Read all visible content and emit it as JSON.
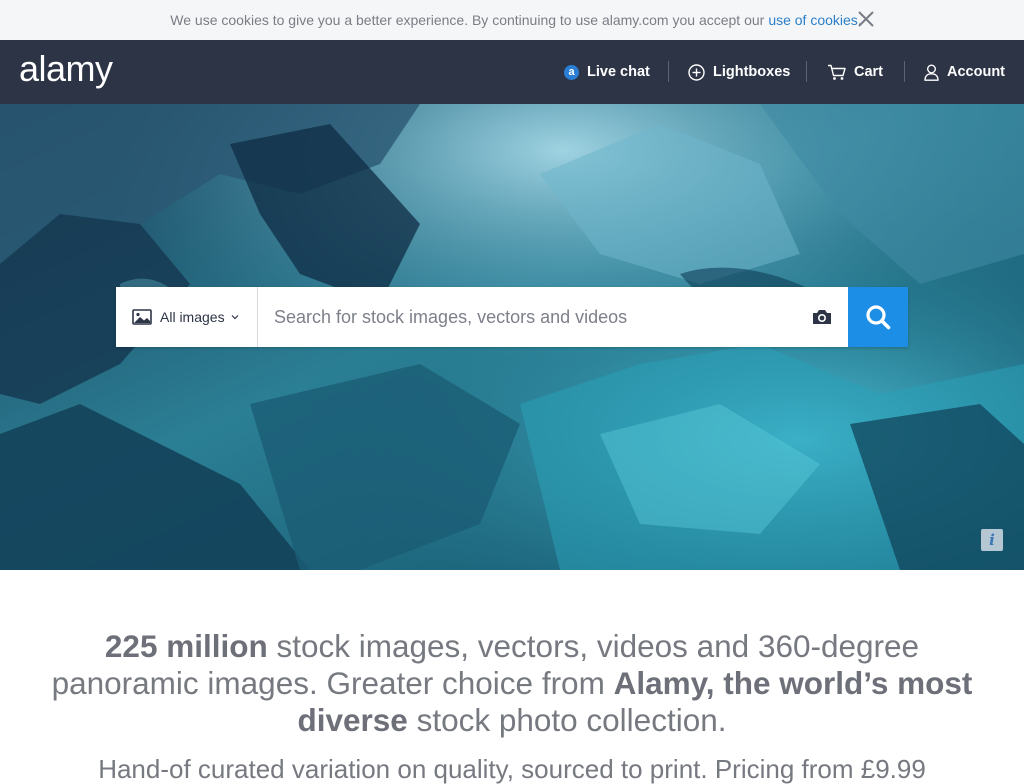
{
  "cookie_bar": {
    "message": "We use cookies to give you a better experience. By continuing to use alamy.com you accept our",
    "link_text": "use of cookies."
  },
  "header": {
    "logo": "alamy",
    "nav": {
      "live_chat": "Live chat",
      "live_chat_badge": "a",
      "lightboxes": "Lightboxes",
      "cart": "Cart",
      "account": "Account"
    }
  },
  "search": {
    "type_selected": "All images",
    "placeholder": "Search for stock images, vectors and videos",
    "value": ""
  },
  "hero": {
    "info_label": "i"
  },
  "tagline": {
    "count": "225 million",
    "text_1": " stock images, vectors, videos and 360-degree panoramic images. Greater choice from ",
    "brand_claim": "Alamy, the world’s most diverse",
    "text_2": " stock photo collection."
  },
  "subline": {
    "text": "Hand-of curated variation on quality, sourced to print. Pricing from £9.99"
  },
  "colors": {
    "header_bg": "#2d3446",
    "accent_blue": "#1d8ee6",
    "link_blue": "#2a7fc9",
    "cookie_bg": "#f5f6f8"
  }
}
